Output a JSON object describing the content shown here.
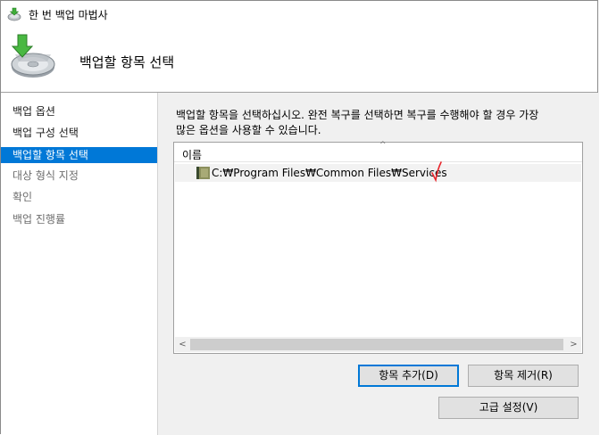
{
  "window": {
    "title": "한 번 백업 마법사"
  },
  "header": {
    "title": "백업할 항목 선택",
    "icon": "backup-disk-icon"
  },
  "sidebar": {
    "steps": [
      {
        "label": "백업 옵션",
        "state": "done"
      },
      {
        "label": "백업 구성 선택",
        "state": "done"
      },
      {
        "label": "백업할 항목 선택",
        "state": "active"
      },
      {
        "label": "대상 형식 지정",
        "state": "pending"
      },
      {
        "label": "확인",
        "state": "pending"
      },
      {
        "label": "백업 진행률",
        "state": "pending"
      }
    ]
  },
  "main": {
    "instruction_line1": "백업할 항목을 선택하십시오. 완전 복구를 선택하면 복구를 수행해야 할 경우 가장",
    "instruction_line2": "많은 옵션을 사용할 수 있습니다.",
    "list": {
      "column_header": "이름",
      "items": [
        {
          "path": "C:₩Program Files₩Common Files₩Services",
          "icon": "folder-icon"
        }
      ]
    },
    "buttons": {
      "add_item": "항목 추가(D)",
      "remove_item": "항목 제거(R)",
      "advanced_settings": "고급 설정(V)"
    }
  },
  "colors": {
    "accent": "#0078d7",
    "content_bg": "#f0f0f0",
    "annotation_red": "#e8262c"
  }
}
